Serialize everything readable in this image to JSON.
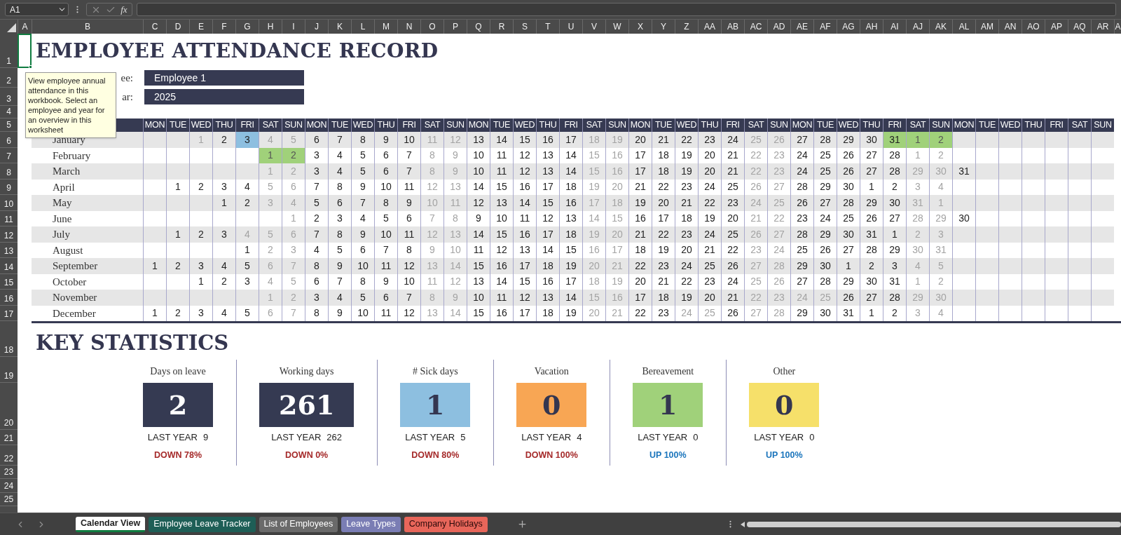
{
  "formula_bar": {
    "name_box": "A1",
    "function_label": "fx"
  },
  "column_headers": [
    "A",
    "B",
    "C",
    "D",
    "E",
    "F",
    "G",
    "H",
    "I",
    "J",
    "K",
    "L",
    "M",
    "N",
    "O",
    "P",
    "Q",
    "R",
    "S",
    "T",
    "U",
    "V",
    "W",
    "X",
    "Y",
    "Z",
    "AA",
    "AB",
    "AC",
    "AD",
    "AE",
    "AF",
    "AG",
    "AH",
    "AI",
    "AJ",
    "AK",
    "AL",
    "AM",
    "AN",
    "AO",
    "AP",
    "AQ",
    "AR",
    "A"
  ],
  "row_numbers": [
    "1",
    "2",
    "3",
    "4",
    "5",
    "6",
    "7",
    "8",
    "9",
    "10",
    "11",
    "12",
    "13",
    "14",
    "15",
    "16",
    "17",
    "18",
    "19",
    "20",
    "21",
    "22",
    "23",
    "24",
    "25"
  ],
  "tooltip": "View employee annual attendance in this workbook. Select an employee and year for an overview in this worksheet",
  "title": "EMPLOYEE ATTENDANCE RECORD",
  "fields": [
    {
      "label": "ee:",
      "value": "Employee 1"
    },
    {
      "label": "ar:",
      "value": "2025"
    }
  ],
  "calendar": {
    "weekdays": [
      "MON",
      "TUE",
      "WED",
      "THU",
      "FRI",
      "SAT",
      "SUN",
      "MON",
      "TUE",
      "WED",
      "THU",
      "FRI",
      "SAT",
      "SUN",
      "MON",
      "TUE",
      "WED",
      "THU",
      "FRI",
      "SAT",
      "SUN",
      "MON",
      "TUE",
      "WED",
      "THU",
      "FRI",
      "SAT",
      "SUN",
      "MON",
      "TUE",
      "WED",
      "THU",
      "FRI",
      "SAT",
      "SUN",
      "MON",
      "TUE",
      "WED",
      "THU",
      "FRI",
      "SAT",
      "SUN"
    ],
    "months": [
      {
        "name": "January",
        "days": [
          {
            "kind": "blank"
          },
          {
            "kind": "blank"
          },
          {
            "day": "1",
            "off": true
          },
          {
            "day": "2",
            "off": false
          },
          {
            "day": "3",
            "off": false,
            "color": "#8dbfe0"
          },
          {
            "day": "4",
            "off": true
          },
          {
            "day": "5",
            "off": true
          },
          {
            "day": "6",
            "off": false
          },
          {
            "day": "7",
            "off": false
          },
          {
            "day": "8",
            "off": false
          },
          {
            "day": "9",
            "off": false
          },
          {
            "day": "10",
            "off": false
          },
          {
            "day": "11",
            "off": true
          },
          {
            "day": "12",
            "off": true
          },
          {
            "day": "13",
            "off": false
          },
          {
            "day": "14",
            "off": false
          },
          {
            "day": "15",
            "off": false
          },
          {
            "day": "16",
            "off": false
          },
          {
            "day": "17",
            "off": false
          },
          {
            "day": "18",
            "off": true
          },
          {
            "day": "19",
            "off": true
          },
          {
            "day": "20",
            "off": false
          },
          {
            "day": "21",
            "off": false
          },
          {
            "day": "22",
            "off": false
          },
          {
            "day": "23",
            "off": false
          },
          {
            "day": "24",
            "off": false
          },
          {
            "day": "25",
            "off": true
          },
          {
            "day": "26",
            "off": true
          },
          {
            "day": "27",
            "off": false
          },
          {
            "day": "28",
            "off": false
          },
          {
            "day": "29",
            "off": false
          },
          {
            "day": "30",
            "off": false
          },
          {
            "day": "31",
            "off": false,
            "color": "#a0d17a"
          },
          {
            "day": "1",
            "off": true,
            "color": "#a0d17a"
          },
          {
            "day": "2",
            "off": true,
            "color": "#a0d17a"
          }
        ]
      },
      {
        "name": "February",
        "days": [
          {
            "kind": "blank"
          },
          {
            "kind": "blank"
          },
          {
            "kind": "blank"
          },
          {
            "kind": "blank"
          },
          {
            "kind": "blank"
          },
          {
            "day": "1",
            "off": true,
            "color": "#a0d17a"
          },
          {
            "day": "2",
            "off": true,
            "color": "#a0d17a"
          },
          {
            "day": "3",
            "off": false
          },
          {
            "day": "4",
            "off": false
          },
          {
            "day": "5",
            "off": false
          },
          {
            "day": "6",
            "off": false
          },
          {
            "day": "7",
            "off": false
          },
          {
            "day": "8",
            "off": true
          },
          {
            "day": "9",
            "off": true
          },
          {
            "day": "10",
            "off": false
          },
          {
            "day": "11",
            "off": false
          },
          {
            "day": "12",
            "off": false
          },
          {
            "day": "13",
            "off": false
          },
          {
            "day": "14",
            "off": false
          },
          {
            "day": "15",
            "off": true
          },
          {
            "day": "16",
            "off": true
          },
          {
            "day": "17",
            "off": false
          },
          {
            "day": "18",
            "off": false
          },
          {
            "day": "19",
            "off": false
          },
          {
            "day": "20",
            "off": false
          },
          {
            "day": "21",
            "off": false
          },
          {
            "day": "22",
            "off": true
          },
          {
            "day": "23",
            "off": true
          },
          {
            "day": "24",
            "off": false
          },
          {
            "day": "25",
            "off": false
          },
          {
            "day": "26",
            "off": false
          },
          {
            "day": "27",
            "off": false
          },
          {
            "day": "28",
            "off": false
          },
          {
            "day": "1",
            "off": true
          },
          {
            "day": "2",
            "off": true
          }
        ]
      },
      {
        "name": "March",
        "days": [
          {
            "kind": "blank"
          },
          {
            "kind": "blank"
          },
          {
            "kind": "blank"
          },
          {
            "kind": "blank"
          },
          {
            "kind": "blank"
          },
          {
            "day": "1",
            "off": true
          },
          {
            "day": "2",
            "off": true
          },
          {
            "day": "3",
            "off": false
          },
          {
            "day": "4",
            "off": false
          },
          {
            "day": "5",
            "off": false
          },
          {
            "day": "6",
            "off": false
          },
          {
            "day": "7",
            "off": false
          },
          {
            "day": "8",
            "off": true
          },
          {
            "day": "9",
            "off": true
          },
          {
            "day": "10",
            "off": false
          },
          {
            "day": "11",
            "off": false
          },
          {
            "day": "12",
            "off": false
          },
          {
            "day": "13",
            "off": false
          },
          {
            "day": "14",
            "off": false
          },
          {
            "day": "15",
            "off": true
          },
          {
            "day": "16",
            "off": true
          },
          {
            "day": "17",
            "off": false
          },
          {
            "day": "18",
            "off": false
          },
          {
            "day": "19",
            "off": false
          },
          {
            "day": "20",
            "off": false
          },
          {
            "day": "21",
            "off": false
          },
          {
            "day": "22",
            "off": true
          },
          {
            "day": "23",
            "off": true
          },
          {
            "day": "24",
            "off": false
          },
          {
            "day": "25",
            "off": false
          },
          {
            "day": "26",
            "off": false
          },
          {
            "day": "27",
            "off": false
          },
          {
            "day": "28",
            "off": false
          },
          {
            "day": "29",
            "off": true
          },
          {
            "day": "30",
            "off": true
          },
          {
            "day": "31",
            "off": false
          }
        ]
      },
      {
        "name": "April",
        "days": [
          {
            "kind": "blank"
          },
          {
            "day": "1",
            "off": false
          },
          {
            "day": "2",
            "off": false
          },
          {
            "day": "3",
            "off": false
          },
          {
            "day": "4",
            "off": false
          },
          {
            "day": "5",
            "off": true
          },
          {
            "day": "6",
            "off": true
          },
          {
            "day": "7",
            "off": false
          },
          {
            "day": "8",
            "off": false
          },
          {
            "day": "9",
            "off": false
          },
          {
            "day": "10",
            "off": false
          },
          {
            "day": "11",
            "off": false
          },
          {
            "day": "12",
            "off": true
          },
          {
            "day": "13",
            "off": true
          },
          {
            "day": "14",
            "off": false
          },
          {
            "day": "15",
            "off": false
          },
          {
            "day": "16",
            "off": false
          },
          {
            "day": "17",
            "off": false
          },
          {
            "day": "18",
            "off": false
          },
          {
            "day": "19",
            "off": true
          },
          {
            "day": "20",
            "off": true
          },
          {
            "day": "21",
            "off": false
          },
          {
            "day": "22",
            "off": false
          },
          {
            "day": "23",
            "off": false
          },
          {
            "day": "24",
            "off": false
          },
          {
            "day": "25",
            "off": false
          },
          {
            "day": "26",
            "off": true
          },
          {
            "day": "27",
            "off": true
          },
          {
            "day": "28",
            "off": false
          },
          {
            "day": "29",
            "off": false
          },
          {
            "day": "30",
            "off": false
          },
          {
            "day": "1",
            "off": false
          },
          {
            "day": "2",
            "off": false
          },
          {
            "day": "3",
            "off": true
          },
          {
            "day": "4",
            "off": true
          }
        ]
      },
      {
        "name": "May",
        "days": [
          {
            "kind": "blank"
          },
          {
            "kind": "blank"
          },
          {
            "kind": "blank"
          },
          {
            "day": "1",
            "off": false
          },
          {
            "day": "2",
            "off": false
          },
          {
            "day": "3",
            "off": true
          },
          {
            "day": "4",
            "off": true
          },
          {
            "day": "5",
            "off": false
          },
          {
            "day": "6",
            "off": false
          },
          {
            "day": "7",
            "off": false
          },
          {
            "day": "8",
            "off": false
          },
          {
            "day": "9",
            "off": false
          },
          {
            "day": "10",
            "off": true
          },
          {
            "day": "11",
            "off": true
          },
          {
            "day": "12",
            "off": false
          },
          {
            "day": "13",
            "off": false
          },
          {
            "day": "14",
            "off": false
          },
          {
            "day": "15",
            "off": false
          },
          {
            "day": "16",
            "off": false
          },
          {
            "day": "17",
            "off": true
          },
          {
            "day": "18",
            "off": true
          },
          {
            "day": "19",
            "off": false
          },
          {
            "day": "20",
            "off": false
          },
          {
            "day": "21",
            "off": false
          },
          {
            "day": "22",
            "off": false
          },
          {
            "day": "23",
            "off": false
          },
          {
            "day": "24",
            "off": true
          },
          {
            "day": "25",
            "off": true
          },
          {
            "day": "26",
            "off": false
          },
          {
            "day": "27",
            "off": false
          },
          {
            "day": "28",
            "off": false
          },
          {
            "day": "29",
            "off": false
          },
          {
            "day": "30",
            "off": false
          },
          {
            "day": "31",
            "off": true
          },
          {
            "day": "1",
            "off": true
          }
        ]
      },
      {
        "name": "June",
        "days": [
          {
            "kind": "blank"
          },
          {
            "kind": "blank"
          },
          {
            "kind": "blank"
          },
          {
            "kind": "blank"
          },
          {
            "kind": "blank"
          },
          {
            "kind": "blank"
          },
          {
            "day": "1",
            "off": true
          },
          {
            "day": "2",
            "off": false
          },
          {
            "day": "3",
            "off": false
          },
          {
            "day": "4",
            "off": false
          },
          {
            "day": "5",
            "off": false
          },
          {
            "day": "6",
            "off": false
          },
          {
            "day": "7",
            "off": true
          },
          {
            "day": "8",
            "off": true
          },
          {
            "day": "9",
            "off": false
          },
          {
            "day": "10",
            "off": false
          },
          {
            "day": "11",
            "off": false
          },
          {
            "day": "12",
            "off": false
          },
          {
            "day": "13",
            "off": false
          },
          {
            "day": "14",
            "off": true
          },
          {
            "day": "15",
            "off": true
          },
          {
            "day": "16",
            "off": false
          },
          {
            "day": "17",
            "off": false
          },
          {
            "day": "18",
            "off": false
          },
          {
            "day": "19",
            "off": false
          },
          {
            "day": "20",
            "off": false
          },
          {
            "day": "21",
            "off": true
          },
          {
            "day": "22",
            "off": true
          },
          {
            "day": "23",
            "off": false
          },
          {
            "day": "24",
            "off": false
          },
          {
            "day": "25",
            "off": false
          },
          {
            "day": "26",
            "off": false
          },
          {
            "day": "27",
            "off": false
          },
          {
            "day": "28",
            "off": true
          },
          {
            "day": "29",
            "off": true
          },
          {
            "day": "30",
            "off": false
          }
        ]
      },
      {
        "name": "July",
        "days": [
          {
            "kind": "blank"
          },
          {
            "day": "1",
            "off": false
          },
          {
            "day": "2",
            "off": false
          },
          {
            "day": "3",
            "off": false
          },
          {
            "day": "4",
            "off": true
          },
          {
            "day": "5",
            "off": true
          },
          {
            "day": "6",
            "off": true
          },
          {
            "day": "7",
            "off": false
          },
          {
            "day": "8",
            "off": false
          },
          {
            "day": "9",
            "off": false
          },
          {
            "day": "10",
            "off": false
          },
          {
            "day": "11",
            "off": false
          },
          {
            "day": "12",
            "off": true
          },
          {
            "day": "13",
            "off": true
          },
          {
            "day": "14",
            "off": false
          },
          {
            "day": "15",
            "off": false
          },
          {
            "day": "16",
            "off": false
          },
          {
            "day": "17",
            "off": false
          },
          {
            "day": "18",
            "off": false
          },
          {
            "day": "19",
            "off": true
          },
          {
            "day": "20",
            "off": true
          },
          {
            "day": "21",
            "off": false
          },
          {
            "day": "22",
            "off": false
          },
          {
            "day": "23",
            "off": false
          },
          {
            "day": "24",
            "off": false
          },
          {
            "day": "25",
            "off": false
          },
          {
            "day": "26",
            "off": true
          },
          {
            "day": "27",
            "off": true
          },
          {
            "day": "28",
            "off": false
          },
          {
            "day": "29",
            "off": false
          },
          {
            "day": "30",
            "off": false
          },
          {
            "day": "31",
            "off": false
          },
          {
            "day": "1",
            "off": false
          },
          {
            "day": "2",
            "off": true
          },
          {
            "day": "3",
            "off": true
          }
        ]
      },
      {
        "name": "August",
        "days": [
          {
            "kind": "blank"
          },
          {
            "kind": "blank"
          },
          {
            "kind": "blank"
          },
          {
            "kind": "blank"
          },
          {
            "day": "1",
            "off": false
          },
          {
            "day": "2",
            "off": true
          },
          {
            "day": "3",
            "off": true
          },
          {
            "day": "4",
            "off": false
          },
          {
            "day": "5",
            "off": false
          },
          {
            "day": "6",
            "off": false
          },
          {
            "day": "7",
            "off": false
          },
          {
            "day": "8",
            "off": false
          },
          {
            "day": "9",
            "off": true
          },
          {
            "day": "10",
            "off": true
          },
          {
            "day": "11",
            "off": false
          },
          {
            "day": "12",
            "off": false
          },
          {
            "day": "13",
            "off": false
          },
          {
            "day": "14",
            "off": false
          },
          {
            "day": "15",
            "off": false
          },
          {
            "day": "16",
            "off": true
          },
          {
            "day": "17",
            "off": true
          },
          {
            "day": "18",
            "off": false
          },
          {
            "day": "19",
            "off": false
          },
          {
            "day": "20",
            "off": false
          },
          {
            "day": "21",
            "off": false
          },
          {
            "day": "22",
            "off": false
          },
          {
            "day": "23",
            "off": true
          },
          {
            "day": "24",
            "off": true
          },
          {
            "day": "25",
            "off": false
          },
          {
            "day": "26",
            "off": false
          },
          {
            "day": "27",
            "off": false
          },
          {
            "day": "28",
            "off": false
          },
          {
            "day": "29",
            "off": false
          },
          {
            "day": "30",
            "off": true
          },
          {
            "day": "31",
            "off": true
          }
        ]
      },
      {
        "name": "September",
        "days": [
          {
            "day": "1",
            "off": false
          },
          {
            "day": "2",
            "off": false
          },
          {
            "day": "3",
            "off": false
          },
          {
            "day": "4",
            "off": false
          },
          {
            "day": "5",
            "off": false
          },
          {
            "day": "6",
            "off": true
          },
          {
            "day": "7",
            "off": true
          },
          {
            "day": "8",
            "off": false
          },
          {
            "day": "9",
            "off": false
          },
          {
            "day": "10",
            "off": false
          },
          {
            "day": "11",
            "off": false
          },
          {
            "day": "12",
            "off": false
          },
          {
            "day": "13",
            "off": true
          },
          {
            "day": "14",
            "off": true
          },
          {
            "day": "15",
            "off": false
          },
          {
            "day": "16",
            "off": false
          },
          {
            "day": "17",
            "off": false
          },
          {
            "day": "18",
            "off": false
          },
          {
            "day": "19",
            "off": false
          },
          {
            "day": "20",
            "off": true
          },
          {
            "day": "21",
            "off": true
          },
          {
            "day": "22",
            "off": false
          },
          {
            "day": "23",
            "off": false
          },
          {
            "day": "24",
            "off": false
          },
          {
            "day": "25",
            "off": false
          },
          {
            "day": "26",
            "off": false
          },
          {
            "day": "27",
            "off": true
          },
          {
            "day": "28",
            "off": true
          },
          {
            "day": "29",
            "off": false
          },
          {
            "day": "30",
            "off": false
          },
          {
            "day": "1",
            "off": false
          },
          {
            "day": "2",
            "off": false
          },
          {
            "day": "3",
            "off": false
          },
          {
            "day": "4",
            "off": true
          },
          {
            "day": "5",
            "off": true
          }
        ]
      },
      {
        "name": "October",
        "days": [
          {
            "kind": "blank"
          },
          {
            "kind": "blank"
          },
          {
            "day": "1",
            "off": false
          },
          {
            "day": "2",
            "off": false
          },
          {
            "day": "3",
            "off": false
          },
          {
            "day": "4",
            "off": true
          },
          {
            "day": "5",
            "off": true
          },
          {
            "day": "6",
            "off": false
          },
          {
            "day": "7",
            "off": false
          },
          {
            "day": "8",
            "off": false
          },
          {
            "day": "9",
            "off": false
          },
          {
            "day": "10",
            "off": false
          },
          {
            "day": "11",
            "off": true
          },
          {
            "day": "12",
            "off": true
          },
          {
            "day": "13",
            "off": false
          },
          {
            "day": "14",
            "off": false
          },
          {
            "day": "15",
            "off": false
          },
          {
            "day": "16",
            "off": false
          },
          {
            "day": "17",
            "off": false
          },
          {
            "day": "18",
            "off": true
          },
          {
            "day": "19",
            "off": true
          },
          {
            "day": "20",
            "off": false
          },
          {
            "day": "21",
            "off": false
          },
          {
            "day": "22",
            "off": false
          },
          {
            "day": "23",
            "off": false
          },
          {
            "day": "24",
            "off": false
          },
          {
            "day": "25",
            "off": true
          },
          {
            "day": "26",
            "off": true
          },
          {
            "day": "27",
            "off": false
          },
          {
            "day": "28",
            "off": false
          },
          {
            "day": "29",
            "off": false
          },
          {
            "day": "30",
            "off": false
          },
          {
            "day": "31",
            "off": false
          },
          {
            "day": "1",
            "off": true
          },
          {
            "day": "2",
            "off": true
          }
        ]
      },
      {
        "name": "November",
        "days": [
          {
            "kind": "blank"
          },
          {
            "kind": "blank"
          },
          {
            "kind": "blank"
          },
          {
            "kind": "blank"
          },
          {
            "kind": "blank"
          },
          {
            "day": "1",
            "off": true
          },
          {
            "day": "2",
            "off": true
          },
          {
            "day": "3",
            "off": false
          },
          {
            "day": "4",
            "off": false
          },
          {
            "day": "5",
            "off": false
          },
          {
            "day": "6",
            "off": false
          },
          {
            "day": "7",
            "off": false
          },
          {
            "day": "8",
            "off": true
          },
          {
            "day": "9",
            "off": true
          },
          {
            "day": "10",
            "off": false
          },
          {
            "day": "11",
            "off": false
          },
          {
            "day": "12",
            "off": false
          },
          {
            "day": "13",
            "off": false
          },
          {
            "day": "14",
            "off": false
          },
          {
            "day": "15",
            "off": true
          },
          {
            "day": "16",
            "off": true
          },
          {
            "day": "17",
            "off": false
          },
          {
            "day": "18",
            "off": false
          },
          {
            "day": "19",
            "off": false
          },
          {
            "day": "20",
            "off": false
          },
          {
            "day": "21",
            "off": false
          },
          {
            "day": "22",
            "off": true
          },
          {
            "day": "23",
            "off": true
          },
          {
            "day": "24",
            "off": true
          },
          {
            "day": "25",
            "off": true
          },
          {
            "day": "26",
            "off": false
          },
          {
            "day": "27",
            "off": false
          },
          {
            "day": "28",
            "off": false
          },
          {
            "day": "29",
            "off": true
          },
          {
            "day": "30",
            "off": true
          }
        ]
      },
      {
        "name": "December",
        "days": [
          {
            "day": "1",
            "off": false
          },
          {
            "day": "2",
            "off": false
          },
          {
            "day": "3",
            "off": false
          },
          {
            "day": "4",
            "off": false
          },
          {
            "day": "5",
            "off": false
          },
          {
            "day": "6",
            "off": true
          },
          {
            "day": "7",
            "off": true
          },
          {
            "day": "8",
            "off": false
          },
          {
            "day": "9",
            "off": false
          },
          {
            "day": "10",
            "off": false
          },
          {
            "day": "11",
            "off": false
          },
          {
            "day": "12",
            "off": false
          },
          {
            "day": "13",
            "off": true
          },
          {
            "day": "14",
            "off": true
          },
          {
            "day": "15",
            "off": false
          },
          {
            "day": "16",
            "off": false
          },
          {
            "day": "17",
            "off": false
          },
          {
            "day": "18",
            "off": false
          },
          {
            "day": "19",
            "off": false
          },
          {
            "day": "20",
            "off": true
          },
          {
            "day": "21",
            "off": true
          },
          {
            "day": "22",
            "off": false
          },
          {
            "day": "23",
            "off": false
          },
          {
            "day": "24",
            "off": true
          },
          {
            "day": "25",
            "off": true
          },
          {
            "day": "26",
            "off": false
          },
          {
            "day": "27",
            "off": true
          },
          {
            "day": "28",
            "off": true
          },
          {
            "day": "29",
            "off": false
          },
          {
            "day": "30",
            "off": false
          },
          {
            "day": "31",
            "off": false
          },
          {
            "day": "1",
            "off": false
          },
          {
            "day": "2",
            "off": false
          },
          {
            "day": "3",
            "off": true
          },
          {
            "day": "4",
            "off": true
          }
        ]
      }
    ]
  },
  "statistics": {
    "title": "KEY STATISTICS",
    "cards": [
      {
        "label": "Days on leave",
        "value": "2",
        "color": "#353a52",
        "last_year_label": "LAST YEAR",
        "last_year": "9",
        "change": {
          "text": "DOWN 78%",
          "color": "#a52a2a"
        }
      },
      {
        "label": "Working days",
        "value": "261",
        "color": "#353a52",
        "last_year_label": "LAST YEAR",
        "last_year": "262",
        "change": {
          "text": "DOWN 0%",
          "color": "#a52a2a"
        }
      },
      {
        "label": "# Sick days",
        "value": "1",
        "color": "#8dbfe0",
        "last_year_label": "LAST YEAR",
        "last_year": "5",
        "change": {
          "text": "DOWN 80%",
          "color": "#a52a2a"
        }
      },
      {
        "label": "Vacation",
        "value": "0",
        "color": "#f8a654",
        "last_year_label": "LAST YEAR",
        "last_year": "4",
        "change": {
          "text": "DOWN 100%",
          "color": "#a52a2a"
        }
      },
      {
        "label": "Bereavement",
        "value": "1",
        "color": "#a0d17a",
        "last_year_label": "LAST YEAR",
        "last_year": "0",
        "change": {
          "text": "UP 100%",
          "color": "#1b75bc"
        }
      },
      {
        "label": "Other",
        "value": "0",
        "color": "#f6e06a",
        "last_year_label": "LAST YEAR",
        "last_year": "0",
        "change": {
          "text": "UP 100%",
          "color": "#1b75bc"
        }
      }
    ]
  },
  "sheet_tabs": [
    {
      "label": "Calendar View",
      "selected": true
    },
    {
      "label": "Employee Leave Tracker",
      "selected": false,
      "color": "#1e5e56"
    },
    {
      "label": "List of Employees",
      "selected": false,
      "color": "#6a6a6a"
    },
    {
      "label": "Leave Types",
      "selected": false,
      "color": "#7a7db4"
    },
    {
      "label": "Company Holidays",
      "selected": false,
      "color": "#e8665a"
    }
  ]
}
